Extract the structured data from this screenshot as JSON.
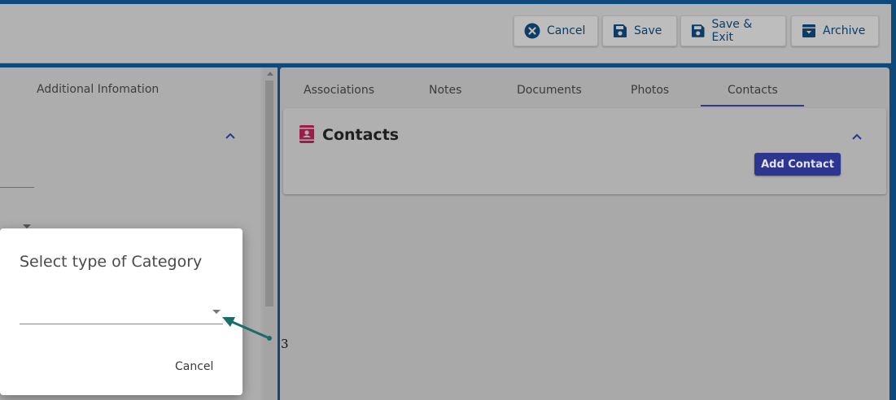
{
  "header": {
    "cancel_label": "Cancel",
    "save_label": "Save",
    "save_exit_label": "Save & Exit",
    "archive_label": "Archive"
  },
  "left_panel": {
    "tab_label": "Additional Infomation"
  },
  "right_panel": {
    "tabs": [
      {
        "label": "Associations"
      },
      {
        "label": "Notes"
      },
      {
        "label": "Documents"
      },
      {
        "label": "Photos"
      },
      {
        "label": "Contacts",
        "active": true
      }
    ],
    "contacts_card": {
      "title": "Contacts",
      "add_button_label": "Add Contact"
    }
  },
  "dialog": {
    "title": "Select type of Category",
    "select_value": "",
    "cancel_label": "Cancel"
  },
  "annotation": {
    "label": "3",
    "color": "#1a6b6b"
  },
  "colors": {
    "brand_blue": "#0b4a7a",
    "button_text": "#0d3d66",
    "primary_button": "#2c3690",
    "contacts_icon": "#9c1c4a"
  }
}
